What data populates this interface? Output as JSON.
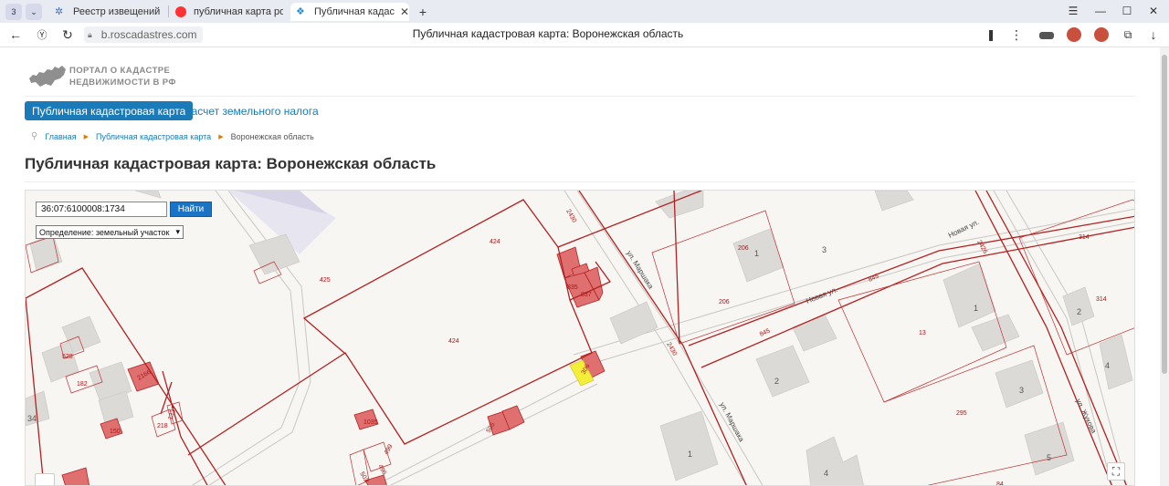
{
  "browser": {
    "tab_counter": "3",
    "tabs": [
      {
        "title": "Реестр извещений"
      },
      {
        "title": "публичная карта росреестра"
      },
      {
        "title": "Публичная кадастровая карта"
      }
    ],
    "url": "b.roscadastres.com",
    "page_title": "Публичная кадастровая карта: Воронежская область"
  },
  "site": {
    "logo_line1": "ПОРТАЛ О КАДАСТРЕ",
    "logo_line2": "НЕДВИЖИМОСТИ В РФ",
    "nav_active": "Публичная кадастровая карта",
    "nav_link": "Расчет земельного налога",
    "breadcrumbs": [
      "Главная",
      "Публичная кадастровая карта",
      "Воронежская область"
    ],
    "heading": "Публичная кадастровая карта: Воронежская область"
  },
  "map": {
    "search_value": "36:07:6100008:1734",
    "search_button": "Найти",
    "definition_select": "Определение: земельный участок",
    "streets": [
      "ул. Маршака",
      "ул. Маршака",
      "Новая ул.",
      "Новая ул.",
      "ул. Жукова"
    ],
    "parcel_labels": [
      "424",
      "424",
      "425",
      "206",
      "206",
      "3",
      "314",
      "314",
      "13",
      "295",
      "845",
      "845",
      "2430",
      "2430",
      "2426",
      "835",
      "837",
      "528",
      "182",
      "2166",
      "150",
      "218",
      "1337",
      "1035",
      "503",
      "496",
      "499",
      "84",
      "34",
      "505",
      "306"
    ],
    "building_labels": [
      "1",
      "1",
      "2",
      "2",
      "3",
      "4",
      "4",
      "5",
      "1"
    ],
    "colors": {
      "boundary": "#b42020",
      "parcel_fill": "#e07070",
      "highlight": "#f2ee3a",
      "building": "#dcdad6",
      "road": "#ffffff"
    }
  }
}
